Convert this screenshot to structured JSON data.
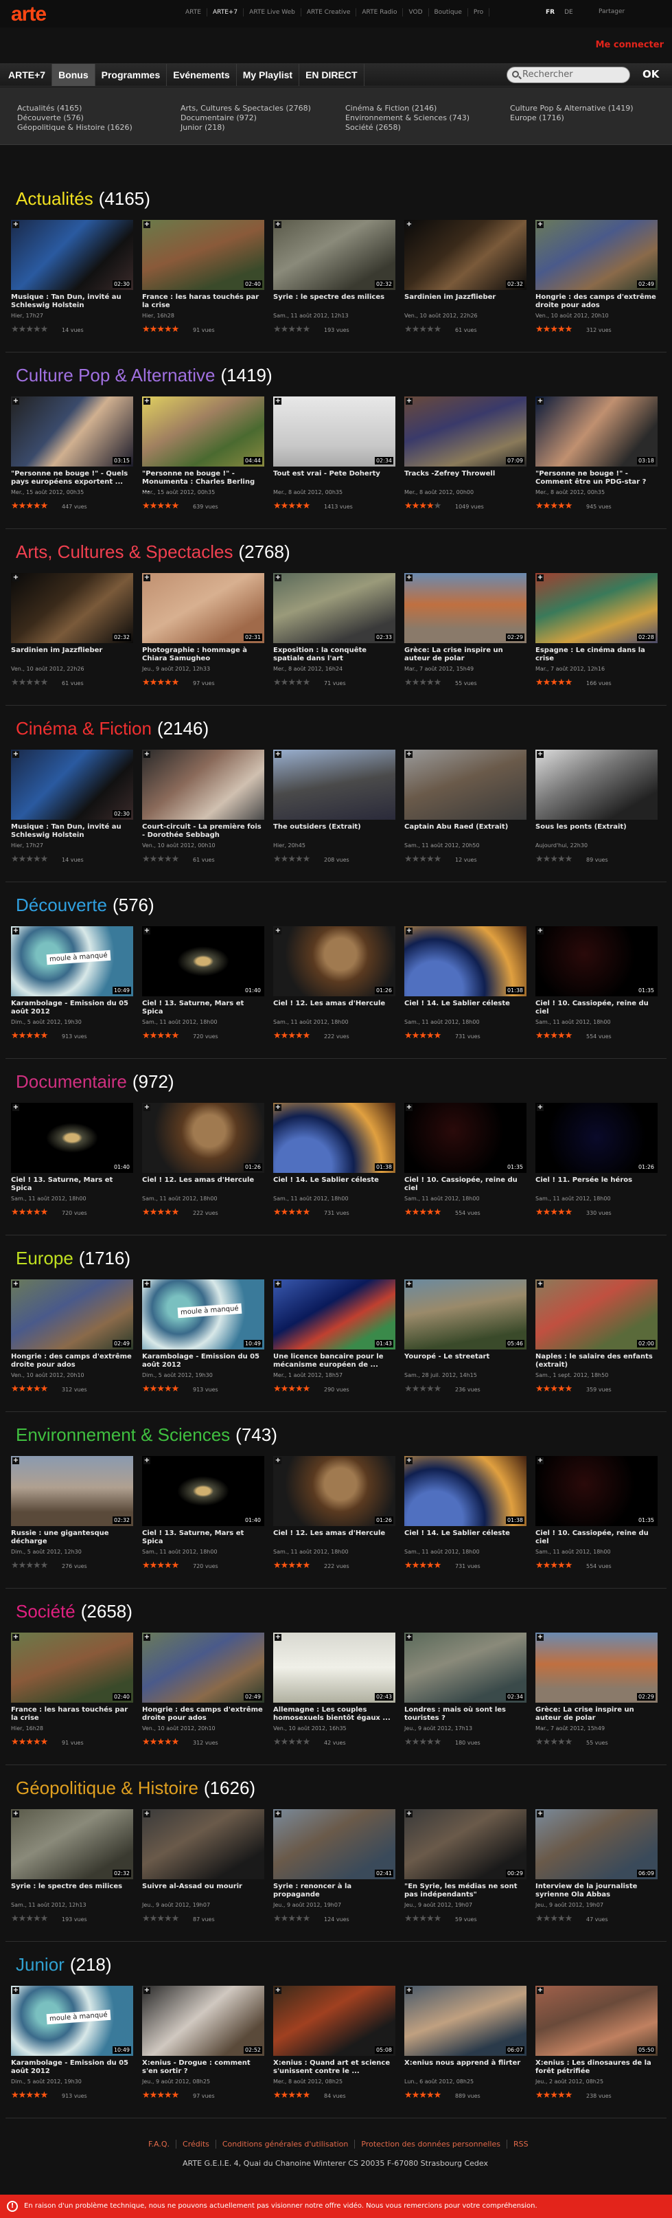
{
  "brand": {
    "logo": "arte"
  },
  "topnav": [
    "ARTE",
    "ARTE+7",
    "ARTE Live Web",
    "ARTE Creative",
    "ARTE Radio",
    "VOD",
    "Boutique",
    "Pro"
  ],
  "langs": [
    "FR",
    "DE"
  ],
  "share": "Partager",
  "connect": "Me connecter",
  "mainnav": [
    "ARTE+7",
    "Bonus",
    "Programmes",
    "Evénements",
    "My Playlist",
    "EN DIRECT"
  ],
  "search": {
    "placeholder": "Rechercher",
    "ok": "OK"
  },
  "categories": [
    "Actualités (4165)",
    "Découverte (576)",
    "Géopolitique & Histoire (1626)",
    "Arts, Cultures & Spectacles (2768)",
    "Documentaire (972)",
    "Junior (218)",
    "Cinéma & Fiction (2146)",
    "Environnement & Sciences (743)",
    "Société (2658)",
    "Culture Pop & Alternative (1419)",
    "Europe (1716)"
  ],
  "colors": {
    "accent": "#ff4713",
    "red": "#e3241b",
    "star": "#ff5510"
  },
  "sections": [
    {
      "name": "Actualités",
      "count": "(4165)",
      "color": "#f0e020",
      "items": [
        {
          "title": "Musique : Tan Dun, invité au Schleswig Holstein",
          "date": "Hier, 17h27",
          "views": "14 vues",
          "dur": "02:30",
          "rating": 0,
          "g": "g0"
        },
        {
          "title": "France : les haras touchés par la crise",
          "date": "Hier, 16h28",
          "views": "91 vues",
          "dur": "02:40",
          "rating": 5,
          "g": "g1"
        },
        {
          "title": "Syrie : le spectre des milices",
          "date": "Sam., 11 août 2012, 12h13",
          "views": "193 vues",
          "dur": "02:32",
          "rating": 0,
          "g": "g2"
        },
        {
          "title": "Sardinien im Jazzflieber",
          "date": "Ven., 10 août 2012, 22h26",
          "views": "61 vues",
          "dur": "02:32",
          "rating": 0,
          "g": "g3"
        },
        {
          "title": "Hongrie : des camps d'extrême droite pour ados",
          "date": "Ven., 10 août 2012, 20h10",
          "views": "312 vues",
          "dur": "02:49",
          "rating": 5,
          "g": "g4"
        }
      ]
    },
    {
      "name": "Culture Pop & Alternative",
      "count": "(1419)",
      "color": "#a070e0",
      "items": [
        {
          "title": "\"Personne ne bouge !\" - Quels pays européens exportent ...",
          "date": "Mer., 15 août 2012, 00h35",
          "views": "447 vues",
          "dur": "03:15",
          "rating": 5,
          "g": "g5"
        },
        {
          "title": "\"Personne ne bouge !\" - Monumenta : Charles Berling ...",
          "date": "Mer., 15 août 2012, 00h35",
          "views": "639 vues",
          "dur": "04:44",
          "rating": 5,
          "g": "g6"
        },
        {
          "title": "Tout est vrai - Pete Doherty",
          "date": "Mer., 8 août 2012, 00h35",
          "views": "1413 vues",
          "dur": "02:34",
          "rating": 5,
          "g": "g7"
        },
        {
          "title": "Tracks -Zefrey Throwell",
          "date": "Mer., 8 août 2012, 00h00",
          "views": "1049 vues",
          "dur": "07:09",
          "rating": 4,
          "g": "g8"
        },
        {
          "title": "\"Personne ne bouge !\" - Comment être un PDG-star ?",
          "date": "Mer., 8 août 2012, 00h35",
          "views": "945 vues",
          "dur": "03:18",
          "rating": 5,
          "g": "g9"
        }
      ]
    },
    {
      "name": "Arts, Cultures & Spectacles",
      "count": "(2768)",
      "color": "#f04050",
      "items": [
        {
          "title": "Sardinien im Jazzflieber",
          "date": "Ven., 10 août 2012, 22h26",
          "views": "61 vues",
          "dur": "02:32",
          "rating": 0,
          "g": "g3"
        },
        {
          "title": "Photographie : hommage à Chiara Samugheo",
          "date": "Jeu., 9 août 2012, 12h33",
          "views": "97 vues",
          "dur": "02:31",
          "rating": 5,
          "g": "g10"
        },
        {
          "title": "Exposition : la conquête spatiale dans l'art",
          "date": "Mer., 8 août 2012, 16h24",
          "views": "71 vues",
          "dur": "02:33",
          "rating": 0,
          "g": "g11"
        },
        {
          "title": "Grèce: La crise inspire un auteur de polar",
          "date": "Mar., 7 août 2012, 15h49",
          "views": "55 vues",
          "dur": "02:29",
          "rating": 0,
          "g": "g12"
        },
        {
          "title": "Espagne : Le cinéma dans la crise",
          "date": "Mar., 7 août 2012, 12h16",
          "views": "166 vues",
          "dur": "02:28",
          "rating": 5,
          "g": "g13"
        }
      ]
    },
    {
      "name": "Cinéma & Fiction",
      "count": "(2146)",
      "color": "#f03030",
      "items": [
        {
          "title": "Musique : Tan Dun, invité au Schleswig Holstein",
          "date": "Hier, 17h27",
          "views": "14 vues",
          "dur": "02:30",
          "rating": 0,
          "g": "g0"
        },
        {
          "title": "Court-circuit - La première fois - Dorothée Sebbagh",
          "date": "Ven., 10 août 2012, 00h10",
          "views": "61 vues",
          "dur": "",
          "rating": 0,
          "g": "g14"
        },
        {
          "title": "The outsiders (Extrait)",
          "date": "Hier, 20h45",
          "views": "208 vues",
          "dur": "",
          "rating": 0,
          "g": "g15"
        },
        {
          "title": "Captain Abu Raed (Extrait)",
          "date": "Sam., 11 août 2012, 20h50",
          "views": "12 vues",
          "dur": "",
          "rating": 0,
          "g": "g16"
        },
        {
          "title": "Sous les ponts (Extrait)",
          "date": "Aujourd'hui, 22h30",
          "views": "89 vues",
          "dur": "",
          "rating": 0,
          "g": "g17"
        }
      ]
    },
    {
      "name": "Découverte",
      "count": "(576)",
      "color": "#30a0e0",
      "items": [
        {
          "title": "Karambolage - Émission du 05 août 2012",
          "date": "Dim., 5 août 2012, 19h30",
          "views": "913 vues",
          "dur": "10:49",
          "rating": 5,
          "g": "g18"
        },
        {
          "title": "Ciel ! 13. Saturne, Mars et Spica",
          "date": "Sam., 11 août 2012, 18h00",
          "views": "720 vues",
          "dur": "01:40",
          "rating": 5,
          "g": "g19"
        },
        {
          "title": "Ciel ! 12. Les amas d'Hercule",
          "date": "Sam., 11 août 2012, 18h00",
          "views": "222 vues",
          "dur": "01:26",
          "rating": 5,
          "g": "g20"
        },
        {
          "title": "Ciel ! 14. Le Sablier céleste",
          "date": "Sam., 11 août 2012, 18h00",
          "views": "731 vues",
          "dur": "01:38",
          "rating": 5,
          "g": "g21"
        },
        {
          "title": "Ciel ! 10. Cassiopée, reine du ciel",
          "date": "Sam., 11 août 2012, 18h00",
          "views": "554 vues",
          "dur": "01:35",
          "rating": 5,
          "g": "g22"
        }
      ]
    },
    {
      "name": "Documentaire",
      "count": "(972)",
      "color": "#d03080",
      "items": [
        {
          "title": "Ciel ! 13. Saturne, Mars et Spica",
          "date": "Sam., 11 août 2012, 18h00",
          "views": "720 vues",
          "dur": "01:40",
          "rating": 5,
          "g": "g19"
        },
        {
          "title": "Ciel ! 12. Les amas d'Hercule",
          "date": "Sam., 11 août 2012, 18h00",
          "views": "222 vues",
          "dur": "01:26",
          "rating": 5,
          "g": "g20"
        },
        {
          "title": "Ciel ! 14. Le Sablier céleste",
          "date": "Sam., 11 août 2012, 18h00",
          "views": "731 vues",
          "dur": "01:38",
          "rating": 5,
          "g": "g21"
        },
        {
          "title": "Ciel ! 10. Cassiopée, reine du ciel",
          "date": "Sam., 11 août 2012, 18h00",
          "views": "554 vues",
          "dur": "01:35",
          "rating": 5,
          "g": "g22"
        },
        {
          "title": "Ciel ! 11. Persée le héros",
          "date": "Sam., 11 août 2012, 18h00",
          "views": "330 vues",
          "dur": "01:26",
          "rating": 5,
          "g": "g23"
        }
      ]
    },
    {
      "name": "Europe",
      "count": "(1716)",
      "color": "#c0e020",
      "items": [
        {
          "title": "Hongrie : des camps d'extrême droite pour ados",
          "date": "Ven., 10 août 2012, 20h10",
          "views": "312 vues",
          "dur": "02:49",
          "rating": 5,
          "g": "g4"
        },
        {
          "title": "Karambolage - Émission du 05 août 2012",
          "date": "Dim., 5 août 2012, 19h30",
          "views": "913 vues",
          "dur": "10:49",
          "rating": 5,
          "g": "g18"
        },
        {
          "title": "Une licence bancaire pour le mécanisme européen de ...",
          "date": "Mer., 1 août 2012, 18h57",
          "views": "290 vues",
          "dur": "01:43",
          "rating": 5,
          "g": "g24"
        },
        {
          "title": "Youropé - Le streetart",
          "date": "Sam., 28 juil. 2012, 14h15",
          "views": "236 vues",
          "dur": "05:46",
          "rating": 0,
          "g": "g25"
        },
        {
          "title": "Naples : le salaire des enfants (extrait)",
          "date": "Sam., 1 sept. 2012, 18h50",
          "views": "359 vues",
          "dur": "02:00",
          "rating": 5,
          "g": "g26"
        }
      ]
    },
    {
      "name": "Environnement & Sciences",
      "count": "(743)",
      "color": "#40c040",
      "items": [
        {
          "title": "Russie : une gigantesque décharge",
          "date": "Dim., 5 août 2012, 12h30",
          "views": "276 vues",
          "dur": "02:32",
          "rating": 0,
          "g": "g27"
        },
        {
          "title": "Ciel ! 13. Saturne, Mars et Spica",
          "date": "Sam., 11 août 2012, 18h00",
          "views": "720 vues",
          "dur": "01:40",
          "rating": 5,
          "g": "g19"
        },
        {
          "title": "Ciel ! 12. Les amas d'Hercule",
          "date": "Sam., 11 août 2012, 18h00",
          "views": "222 vues",
          "dur": "01:26",
          "rating": 5,
          "g": "g20"
        },
        {
          "title": "Ciel ! 14. Le Sablier céleste",
          "date": "Sam., 11 août 2012, 18h00",
          "views": "731 vues",
          "dur": "01:38",
          "rating": 5,
          "g": "g21"
        },
        {
          "title": "Ciel ! 10. Cassiopée, reine du ciel",
          "date": "Sam., 11 août 2012, 18h00",
          "views": "554 vues",
          "dur": "01:35",
          "rating": 5,
          "g": "g22"
        }
      ]
    },
    {
      "name": "Société",
      "count": "(2658)",
      "color": "#e02080",
      "items": [
        {
          "title": "France : les haras touchés par la crise",
          "date": "Hier, 16h28",
          "views": "91 vues",
          "dur": "02:40",
          "rating": 5,
          "g": "g1"
        },
        {
          "title": "Hongrie : des camps d'extrême droite pour ados",
          "date": "Ven., 10 août 2012, 20h10",
          "views": "312 vues",
          "dur": "02:49",
          "rating": 5,
          "g": "g4"
        },
        {
          "title": "Allemagne : Les couples homosexuels bientôt égaux ...",
          "date": "Ven., 10 août 2012, 16h35",
          "views": "42 vues",
          "dur": "02:43",
          "rating": 0,
          "g": "g28"
        },
        {
          "title": "Londres : mais où sont les touristes ?",
          "date": "Jeu., 9 août 2012, 17h13",
          "views": "180 vues",
          "dur": "02:34",
          "rating": 0,
          "g": "g29"
        },
        {
          "title": "Grèce: La crise inspire un auteur de polar",
          "date": "Mar., 7 août 2012, 15h49",
          "views": "55 vues",
          "dur": "02:29",
          "rating": 0,
          "g": "g12"
        }
      ]
    },
    {
      "name": "Géopolitique & Histoire",
      "count": "(1626)",
      "color": "#e0a020",
      "items": [
        {
          "title": "Syrie : le spectre des milices",
          "date": "Sam., 11 août 2012, 12h13",
          "views": "193 vues",
          "dur": "02:32",
          "rating": 0,
          "g": "g2"
        },
        {
          "title": "Suivre al-Assad ou mourir",
          "date": "Jeu., 9 août 2012, 19h07",
          "views": "87 vues",
          "dur": "",
          "rating": 0,
          "g": "g30"
        },
        {
          "title": "Syrie : renoncer à la propagande",
          "date": "Jeu., 9 août 2012, 19h07",
          "views": "124 vues",
          "dur": "02:41",
          "rating": 0,
          "g": "g31"
        },
        {
          "title": "\"En Syrie, les médias ne sont pas indépendants\"",
          "date": "Jeu., 9 août 2012, 19h07",
          "views": "59 vues",
          "dur": "00:29",
          "rating": 0,
          "g": "g30"
        },
        {
          "title": "Interview de la journaliste syrienne Ola Abbas",
          "date": "Jeu., 9 août 2012, 19h07",
          "views": "47 vues",
          "dur": "06:09",
          "rating": 0,
          "g": "g31"
        }
      ]
    },
    {
      "name": "Junior",
      "count": "(218)",
      "color": "#30a0d0",
      "items": [
        {
          "title": "Karambolage - Émission du 05 août 2012",
          "date": "Dim., 5 août 2012, 19h30",
          "views": "913 vues",
          "dur": "10:49",
          "rating": 5,
          "g": "g18"
        },
        {
          "title": "X:enius - Drogue : comment s'en sortir ?",
          "date": "Jeu., 9 août 2012, 08h25",
          "views": "97 vues",
          "dur": "02:52",
          "rating": 5,
          "g": "g32"
        },
        {
          "title": "X:enius : Quand art et science s'unissent contre le ...",
          "date": "Mer., 8 août 2012, 08h25",
          "views": "84 vues",
          "dur": "05:08",
          "rating": 5,
          "g": "g33"
        },
        {
          "title": "X:enius nous apprend à flirter",
          "date": "Lun., 6 août 2012, 08h25",
          "views": "889 vues",
          "dur": "06:07",
          "rating": 5,
          "g": "g34"
        },
        {
          "title": "X:enius : Les dinosaures de la forêt pétrifiée",
          "date": "Jeu., 2 août 2012, 08h25",
          "views": "238 vues",
          "dur": "05:50",
          "rating": 5,
          "g": "g35"
        }
      ]
    }
  ],
  "thumb_labels": {
    "karambolage": "moule à manqué"
  },
  "footer": {
    "links": [
      "F.A.Q.",
      "Crédits",
      "Conditions générales d'utilisation",
      "Protection des données personnelles",
      "RSS"
    ],
    "address": "ARTE G.E.I.E. 4, Quai du Chanoine Winterer CS 20035 F-67080 Strasbourg Cedex"
  },
  "error": {
    "icon": "warning-icon",
    "text": "En raison d'un problème technique, nous ne pouvons actuellement pas visionner notre offre vidéo. Nous vous remercions pour votre compréhension."
  }
}
